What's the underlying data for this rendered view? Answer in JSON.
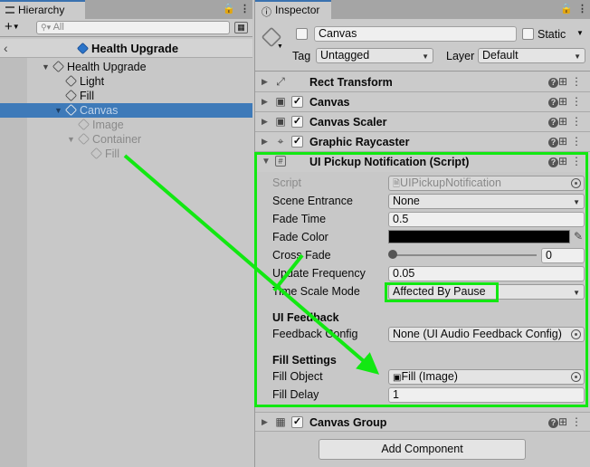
{
  "hierarchy": {
    "tab_label": "Hierarchy",
    "search_placeholder": "All",
    "scene_name": "Health Upgrade",
    "items": [
      {
        "label": "Health Upgrade"
      },
      {
        "label": "Light"
      },
      {
        "label": "Fill"
      },
      {
        "label": "Canvas"
      },
      {
        "label": "Image"
      },
      {
        "label": "Container"
      },
      {
        "label": "Fill"
      }
    ]
  },
  "inspector": {
    "tab_label": "Inspector",
    "object_name": "Canvas",
    "static_label": "Static",
    "tag_label": "Tag",
    "tag_value": "Untagged",
    "layer_label": "Layer",
    "layer_value": "Default",
    "components": [
      {
        "name": "Rect Transform"
      },
      {
        "name": "Canvas"
      },
      {
        "name": "Canvas Scaler"
      },
      {
        "name": "Graphic Raycaster"
      },
      {
        "name": "UI Pickup Notification (Script)"
      },
      {
        "name": "Canvas Group"
      }
    ],
    "script_props": {
      "script_label": "Script",
      "script_value": "UIPickupNotification",
      "scene_entrance_label": "Scene Entrance",
      "scene_entrance_value": "None",
      "fade_time_label": "Fade Time",
      "fade_time_value": "0.5",
      "fade_color_label": "Fade Color",
      "fade_color": "#000000",
      "cross_fade_label": "Cross Fade",
      "cross_fade_value": "0",
      "update_frequency_label": "Update Frequency",
      "update_frequency_value": "0.05",
      "time_scale_mode_label": "Time Scale Mode",
      "time_scale_mode_value": "Affected By Pause",
      "ui_feedback_header": "UI Feedback",
      "feedback_config_label": "Feedback Config",
      "feedback_config_value": "None (UI Audio Feedback Config)",
      "fill_settings_header": "Fill Settings",
      "fill_object_label": "Fill Object",
      "fill_object_value": "Fill (Image)",
      "fill_delay_label": "Fill Delay",
      "fill_delay_value": "1"
    },
    "add_component_label": "Add Component"
  },
  "colors": {
    "highlight": "#12e812",
    "selection": "#3e7ab9"
  }
}
